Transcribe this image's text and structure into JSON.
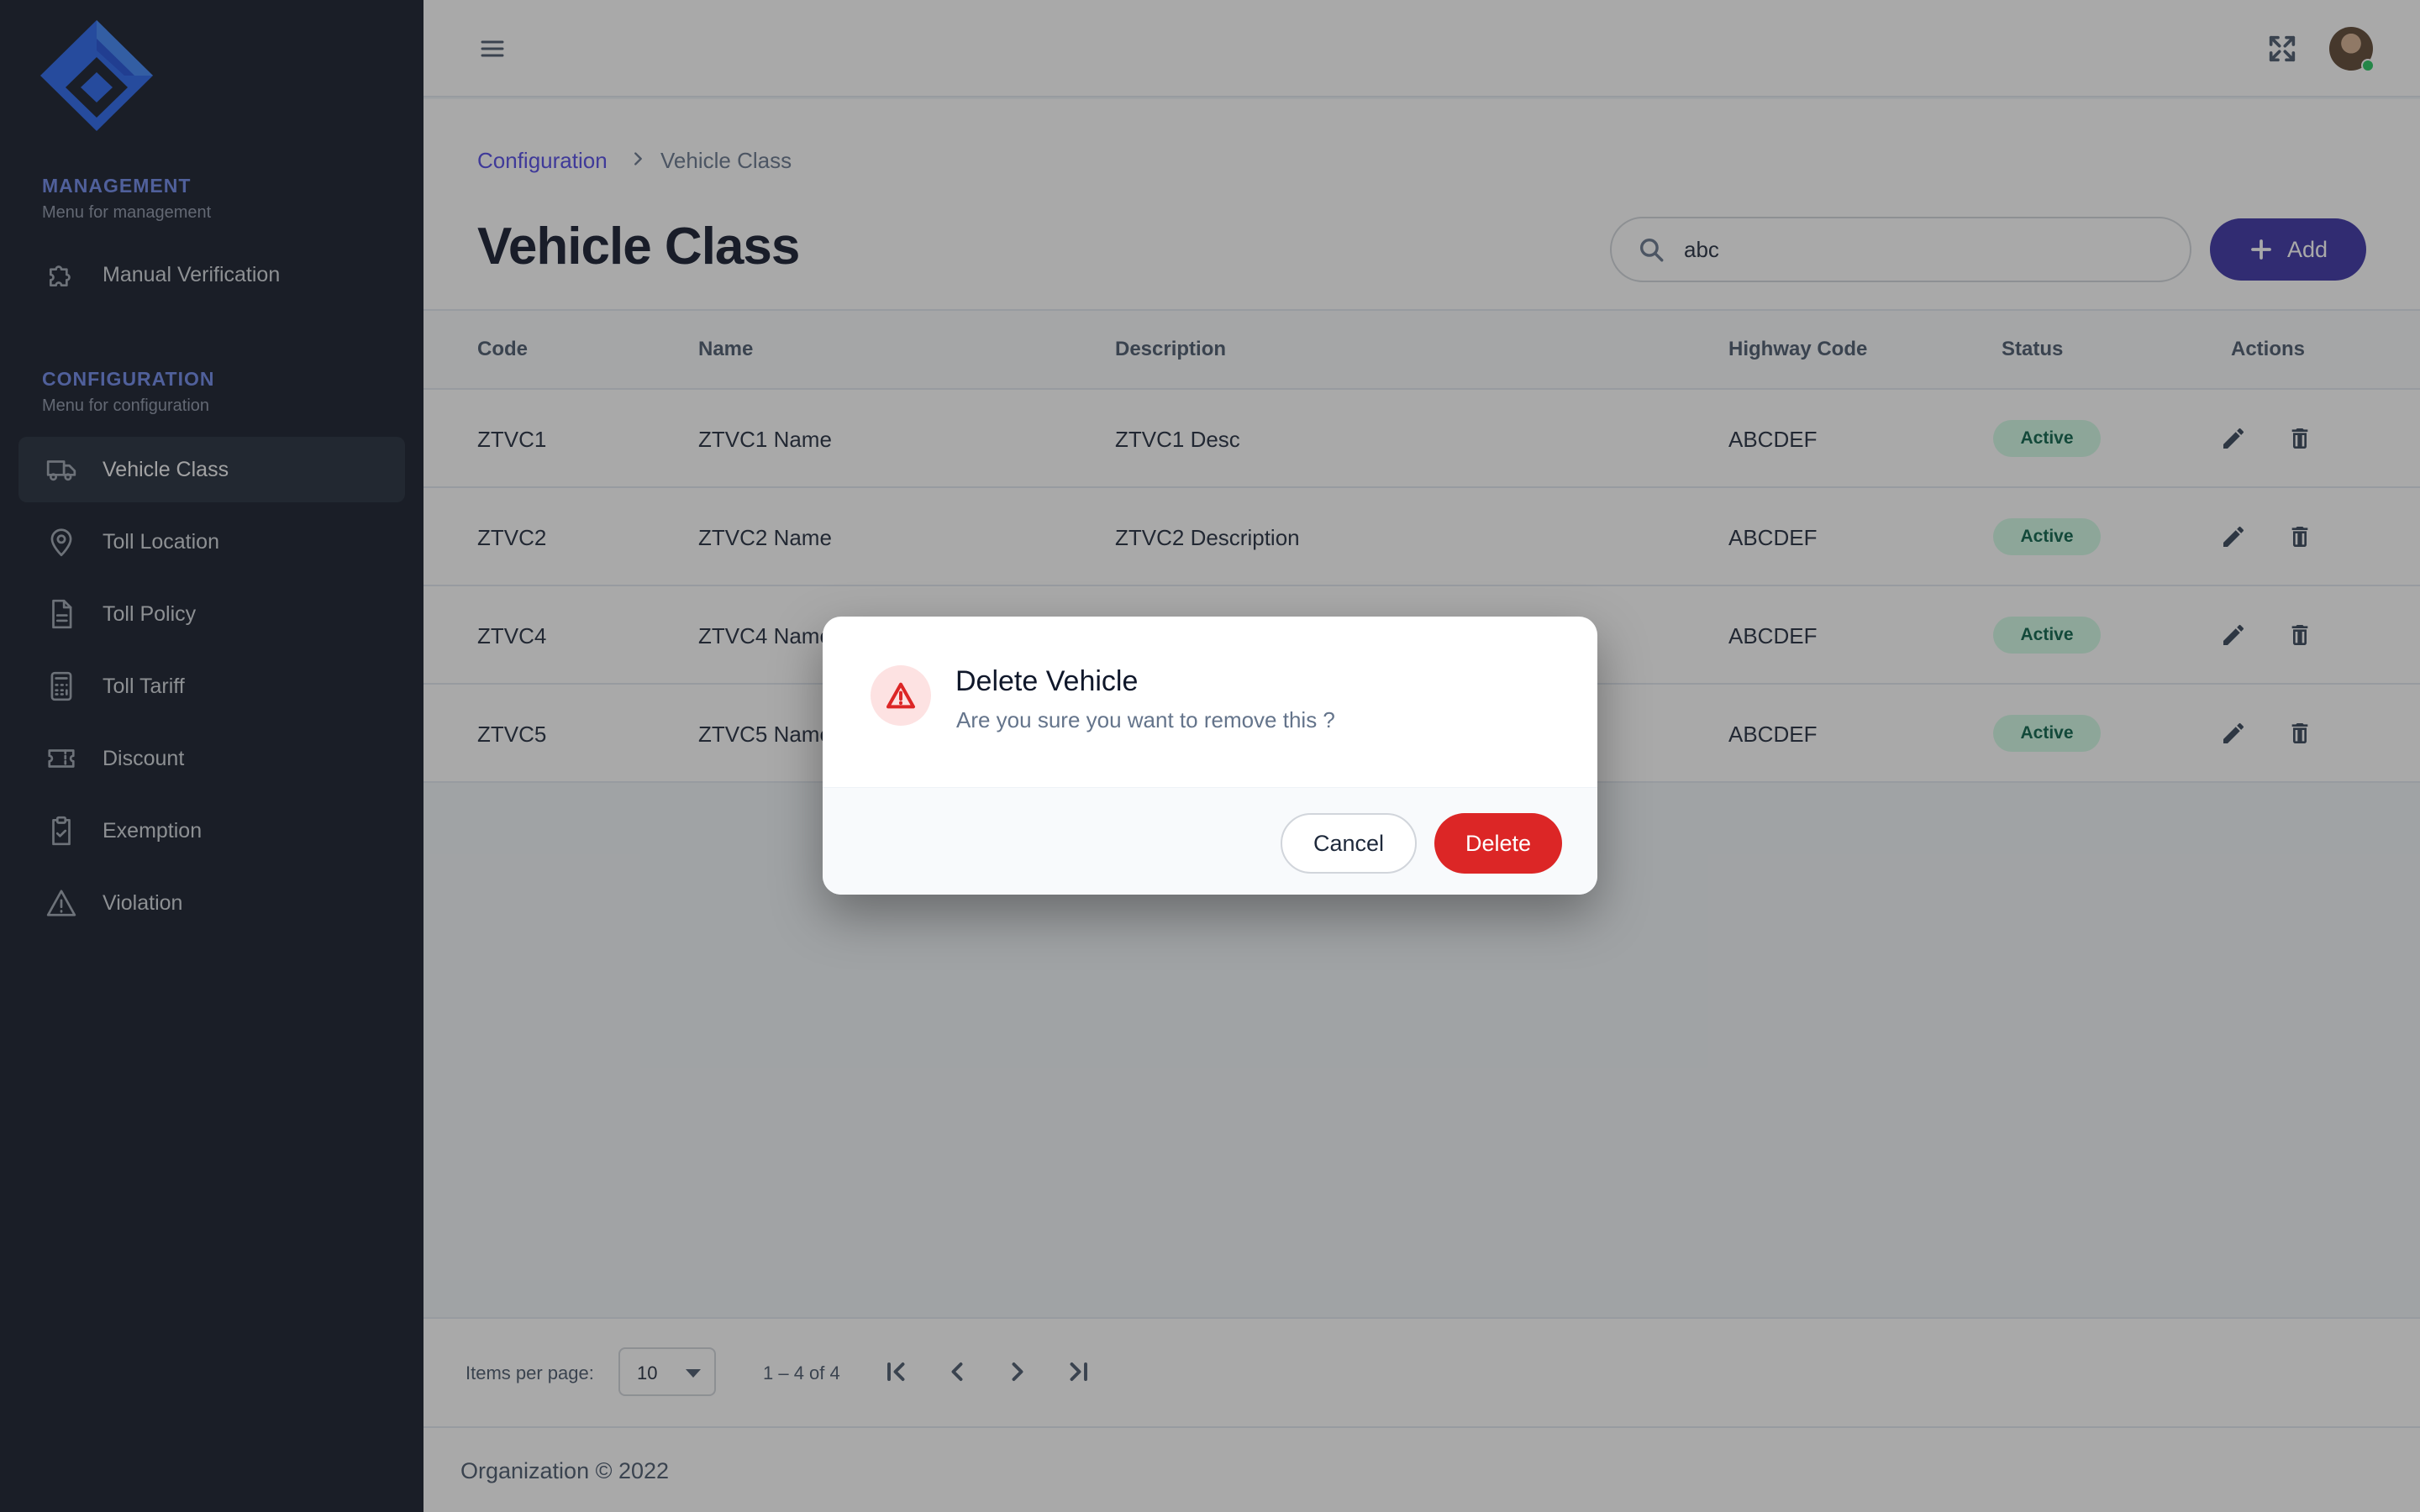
{
  "sidebar": {
    "sections": [
      {
        "title": "MANAGEMENT",
        "subtitle": "Menu for management"
      },
      {
        "title": "CONFIGURATION",
        "subtitle": "Menu for configuration"
      }
    ],
    "items": [
      {
        "label": "Manual Verification",
        "icon": "puzzle-icon",
        "active": false
      },
      {
        "label": "Vehicle Class",
        "icon": "truck-icon",
        "active": true
      },
      {
        "label": "Toll Location",
        "icon": "map-pin-icon",
        "active": false
      },
      {
        "label": "Toll Policy",
        "icon": "document-icon",
        "active": false
      },
      {
        "label": "Toll Tariff",
        "icon": "calculator-icon",
        "active": false
      },
      {
        "label": "Discount",
        "icon": "ticket-icon",
        "active": false
      },
      {
        "label": "Exemption",
        "icon": "clipboard-check-icon",
        "active": false
      },
      {
        "label": "Violation",
        "icon": "warning-icon",
        "active": false
      }
    ]
  },
  "breadcrumb": {
    "parent": "Configuration",
    "current": "Vehicle Class"
  },
  "page": {
    "title": "Vehicle Class"
  },
  "search": {
    "value": "abc"
  },
  "toolbar": {
    "add_label": "Add"
  },
  "table": {
    "columns": [
      "Code",
      "Name",
      "Description",
      "Highway Code",
      "Status",
      "Actions"
    ],
    "rows": [
      {
        "code": "ZTVC1",
        "name": "ZTVC1 Name",
        "description": "ZTVC1 Desc",
        "highway_code": "ABCDEF",
        "status": "Active"
      },
      {
        "code": "ZTVC2",
        "name": "ZTVC2 Name",
        "description": "ZTVC2 Description",
        "highway_code": "ABCDEF",
        "status": "Active"
      },
      {
        "code": "ZTVC4",
        "name": "ZTVC4 Name",
        "description": "",
        "highway_code": "ABCDEF",
        "status": "Active"
      },
      {
        "code": "ZTVC5",
        "name": "ZTVC5 Name",
        "description": "",
        "highway_code": "ABCDEF",
        "status": "Active"
      }
    ]
  },
  "paginator": {
    "items_label": "Items per page:",
    "page_size": "10",
    "range": "1 – 4 of 4"
  },
  "footer": {
    "text": "Organization © 2022"
  },
  "dialog": {
    "title": "Delete Vehicle",
    "message": "Are you sure you want to remove this ?",
    "cancel_label": "Cancel",
    "delete_label": "Delete"
  },
  "colors": {
    "accent": "#3730a3",
    "danger": "#dc2626",
    "sidebar_bg": "#111827",
    "active_badge": "#d1fae5"
  }
}
